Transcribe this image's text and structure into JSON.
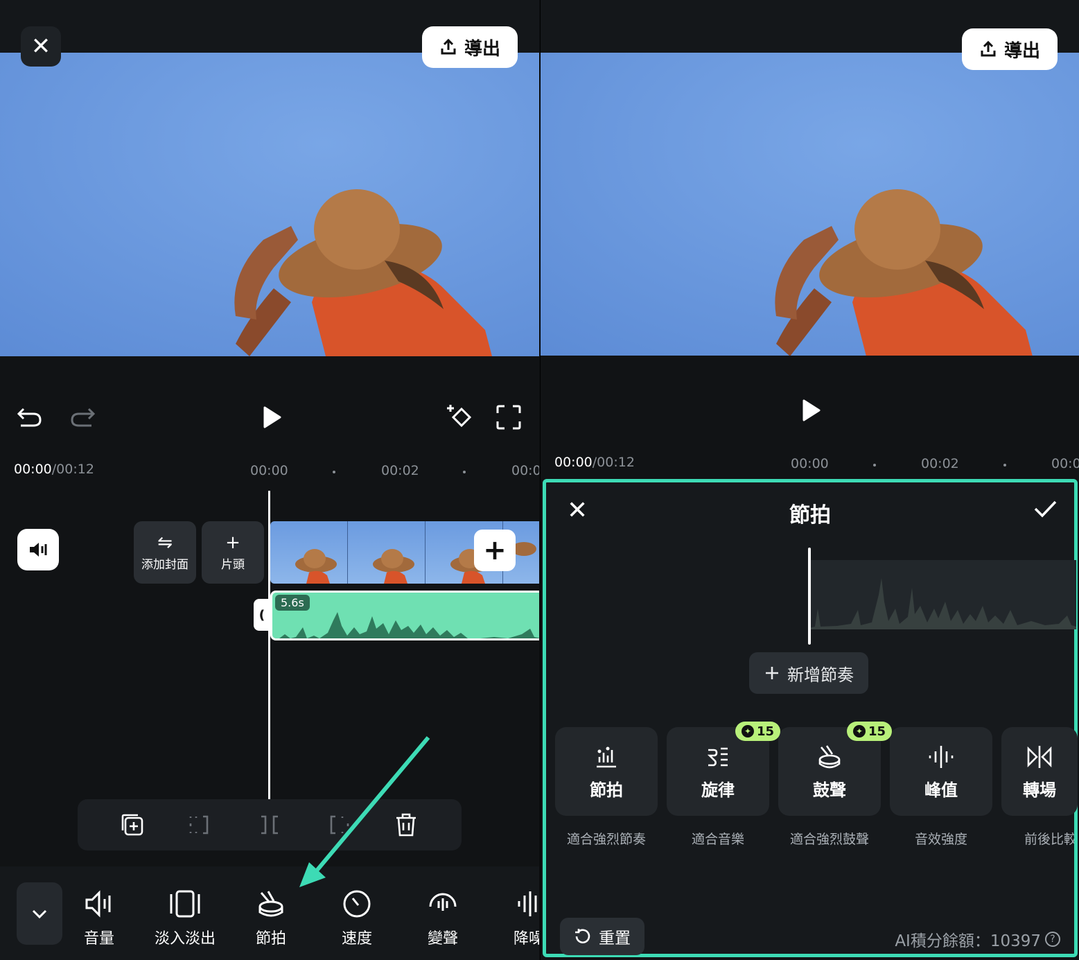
{
  "left": {
    "close_icon": "✕",
    "export_label": "導出",
    "timecode_current": "00:00",
    "timecode_total": "/00:12",
    "ruler_ticks": [
      "00:00",
      "00:02",
      "00:0"
    ],
    "cover_tile": {
      "label": "添加封面",
      "icon": "⇋"
    },
    "intro_tile": {
      "label": "片頭",
      "icon": "+"
    },
    "add_clip_label": "+",
    "audio_duration": "5.6s",
    "handle_glyph": "❪",
    "tools": [
      {
        "label": "音量",
        "icon": "volume-icon"
      },
      {
        "label": "淡入淡出",
        "icon": "fade-icon"
      },
      {
        "label": "節拍",
        "icon": "beat-drum-icon"
      },
      {
        "label": "速度",
        "icon": "speed-icon"
      },
      {
        "label": "變聲",
        "icon": "voice-change-icon"
      },
      {
        "label": "降噪",
        "icon": "denoise-icon"
      }
    ]
  },
  "right": {
    "export_label": "導出",
    "timecode_current": "00:00",
    "timecode_total": "/00:12",
    "ruler_ticks": [
      "00:00",
      "00:02",
      "00:0"
    ],
    "beat_panel": {
      "title": "節拍",
      "close_icon": "✕",
      "add_beat_label": "新增節奏",
      "modes": [
        {
          "label": "節拍",
          "desc": "適合強烈節奏",
          "icon": "beat-bars-icon",
          "cost": ""
        },
        {
          "label": "旋律",
          "desc": "適合音樂",
          "icon": "melody-icon",
          "cost": "15"
        },
        {
          "label": "鼓聲",
          "desc": "適合強烈鼓聲",
          "icon": "drum-icon",
          "cost": "15"
        },
        {
          "label": "峰值",
          "desc": "音效強度",
          "icon": "peak-icon",
          "cost": ""
        },
        {
          "label": "轉場",
          "desc": "前後比較",
          "icon": "transition-icon",
          "cost": ""
        }
      ],
      "reset_label": "重置",
      "credits_label": "AI積分餘額：10397",
      "help_glyph": "?"
    }
  },
  "colors": {
    "accent_teal": "#3ddbb5",
    "audio_green": "#6fe0b2",
    "cost_badge": "#b8f07a"
  }
}
